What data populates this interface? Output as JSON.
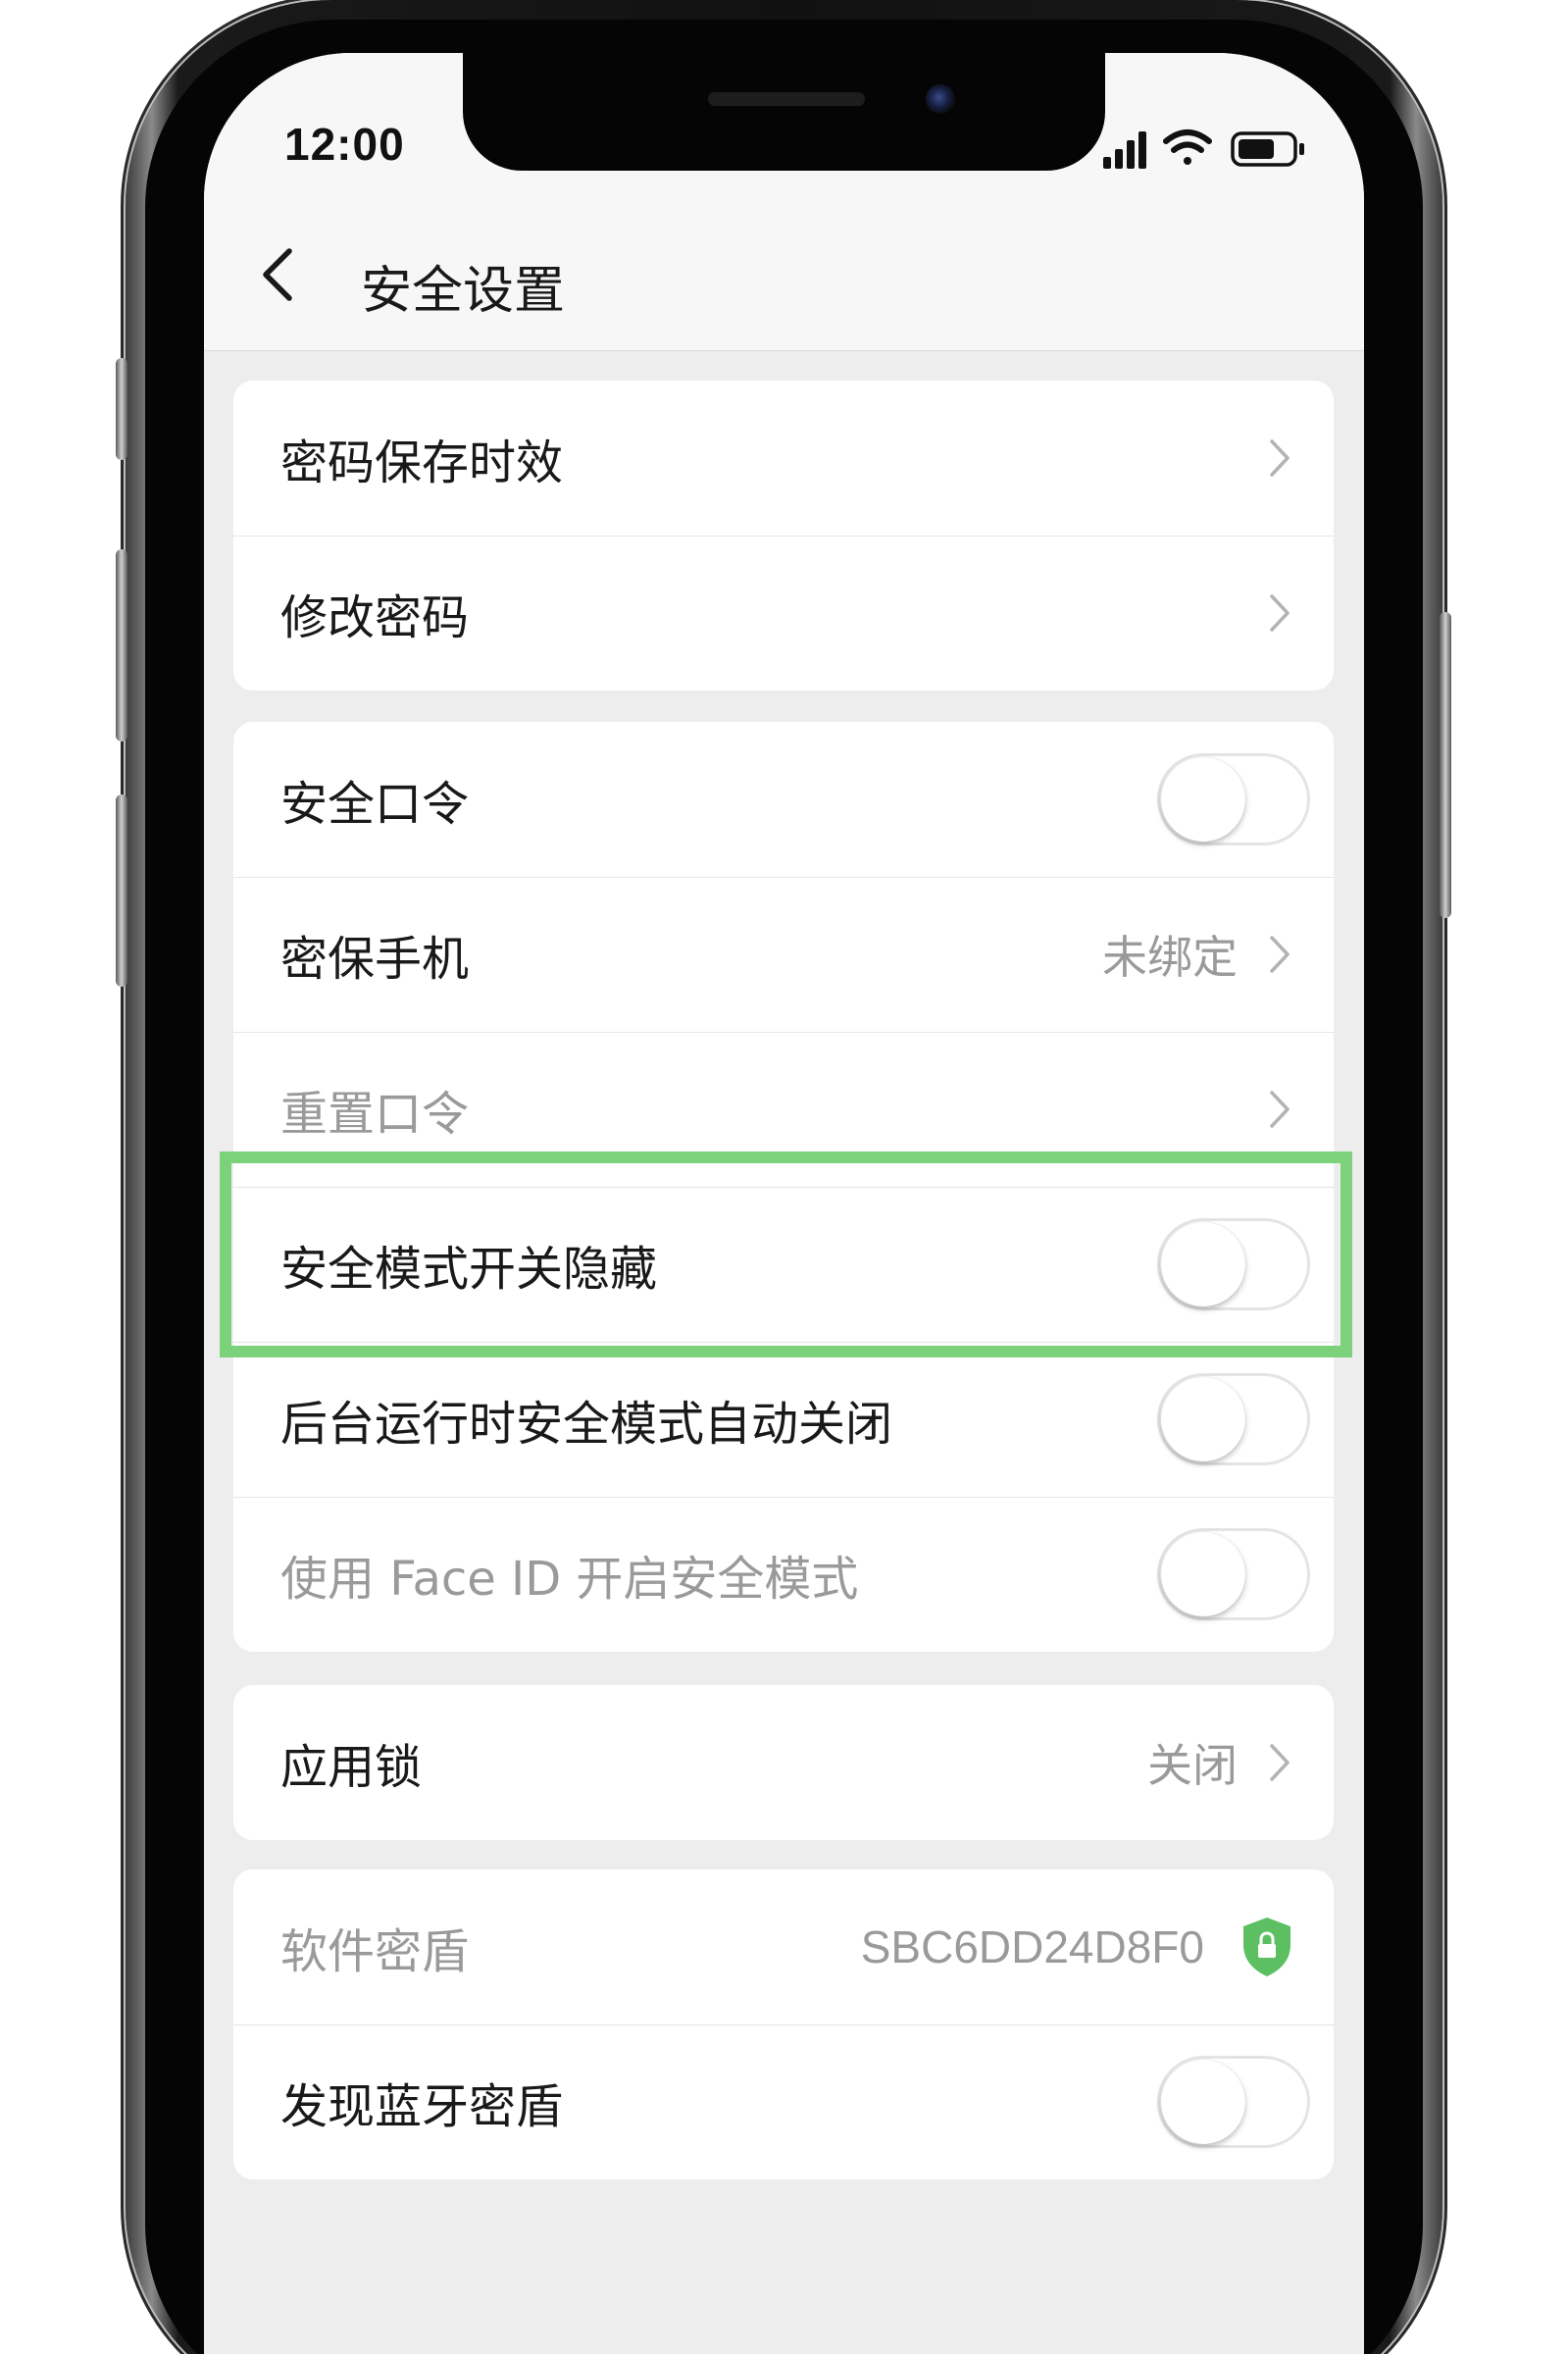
{
  "status_bar": {
    "time": "12:00"
  },
  "nav": {
    "title": "安全设置"
  },
  "groups": [
    {
      "rows": [
        {
          "label": "密码保存时效",
          "control": "chevron"
        },
        {
          "label": "修改密码",
          "control": "chevron"
        }
      ]
    },
    {
      "rows": [
        {
          "label": "安全口令",
          "control": "toggle",
          "on": false
        },
        {
          "label": "密保手机",
          "value": "未绑定",
          "control": "chevron"
        },
        {
          "label": "重置口令",
          "control": "chevron",
          "disabled": true
        },
        {
          "label": "安全模式开关隐藏",
          "control": "toggle",
          "on": false,
          "highlighted": true
        },
        {
          "label": "后台运行时安全模式自动关闭",
          "control": "toggle",
          "on": false
        },
        {
          "label": "使用 Face ID 开启安全模式",
          "control": "toggle",
          "on": false,
          "disabled": true
        }
      ]
    },
    {
      "rows": [
        {
          "label": "应用锁",
          "value": "关闭",
          "control": "chevron"
        }
      ]
    },
    {
      "rows": [
        {
          "label": "软件密盾",
          "value": "SBC6DD24D8F0",
          "control": "shield-icon",
          "disabled": true
        },
        {
          "label": "发现蓝牙密盾",
          "control": "toggle",
          "on": false
        }
      ]
    }
  ],
  "colors": {
    "highlight_border": "#7cd27a",
    "shield_green": "#5cbf62",
    "screen_background": "#ededed"
  }
}
